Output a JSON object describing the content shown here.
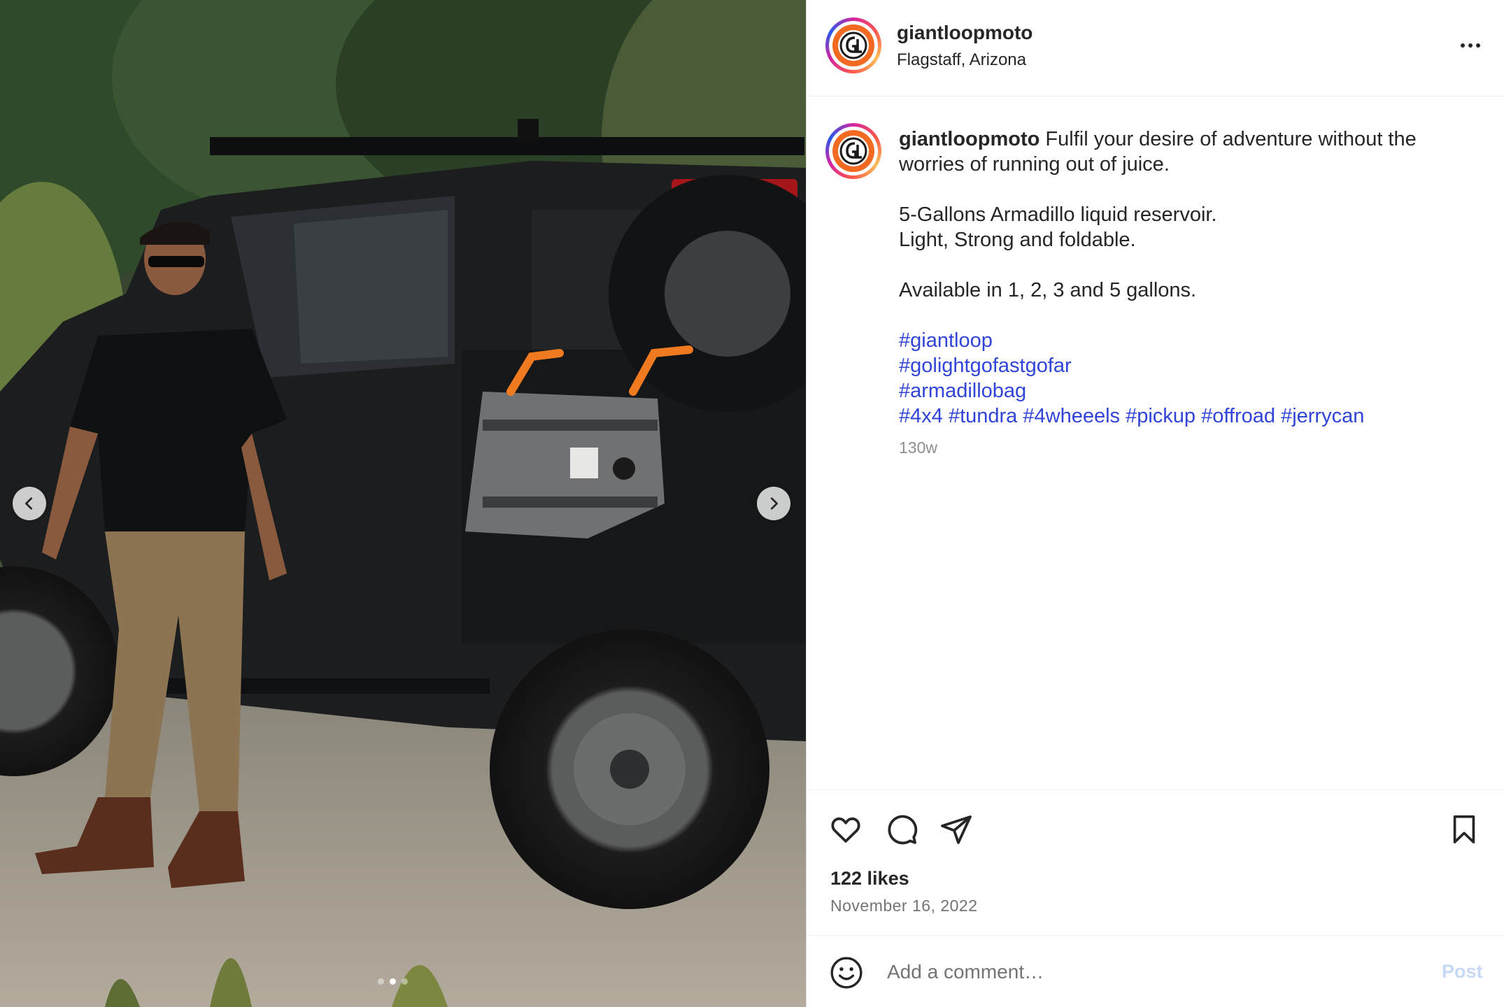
{
  "media": {
    "prev_icon": "chevron-left-icon",
    "next_icon": "chevron-right-icon",
    "carousel": {
      "count": 3,
      "active_index": 1
    }
  },
  "header": {
    "username": "giantloopmoto",
    "location": "Flagstaff, Arizona",
    "avatar_letters": "GL",
    "more_icon": "more-horizontal-icon"
  },
  "caption": {
    "username": "giantloopmoto",
    "text_line1": "Fulfil your desire of adventure without the worries of running out of juice.",
    "line2": "5-Gallons Armadillo liquid reservoir.",
    "line3": "Light, Strong and foldable.",
    "line4": "Available in 1, 2, 3 and 5 gallons.",
    "hashtags_line1": "#giantloop",
    "hashtags_line2": "#golightgofastgofar",
    "hashtags_line3": "#armadillobag",
    "hashtags_line4": [
      "#4x4",
      "#tundra",
      "#4wheeels",
      "#pickup",
      "#offroad",
      "#jerrycan"
    ],
    "time_ago": "130w"
  },
  "actions": {
    "like_icon": "heart-icon",
    "comment_icon": "comment-icon",
    "share_icon": "paper-plane-icon",
    "save_icon": "bookmark-icon",
    "likes": "122 likes",
    "date": "November 16, 2022"
  },
  "comment_box": {
    "emoji_icon": "smiley-icon",
    "placeholder": "Add a comment…",
    "post_label": "Post"
  },
  "colors": {
    "hashtag": "#3044d8",
    "post_button_disabled": "#c5d9f7",
    "avatar_orange": "#f26a21",
    "bag_strap_orange": "#f07a1f"
  }
}
